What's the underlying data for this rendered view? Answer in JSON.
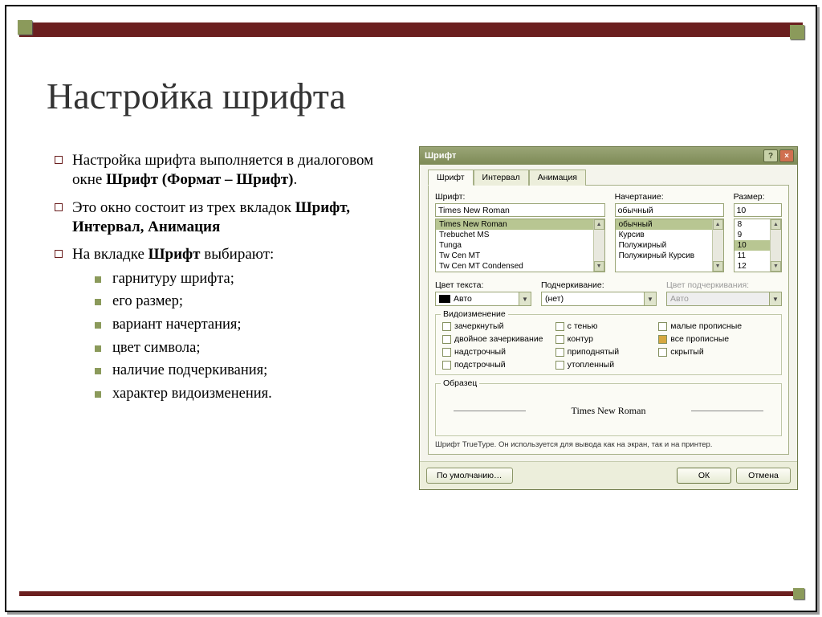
{
  "slide": {
    "title": "Настройка шрифта",
    "bullets": [
      {
        "pre": "Настройка шрифта выполняется в диалоговом окне ",
        "b": "Шрифт (Формат – Шрифт)",
        "post": "."
      },
      {
        "pre": "Это окно состоит из трех вкладок ",
        "b": "Шрифт, Интервал, Анимация",
        "post": ""
      },
      {
        "pre": "На вкладке ",
        "b": "Шрифт",
        "post": " выбирают:",
        "sub": [
          "гарнитуру шрифта;",
          "его размер;",
          "вариант начертания;",
          "цвет символа;",
          "наличие подчеркивания;",
          "характер видоизменения."
        ]
      }
    ]
  },
  "dialog": {
    "title": "Шрифт",
    "help_label": "?",
    "close_label": "×",
    "tabs": [
      "Шрифт",
      "Интервал",
      "Анимация"
    ],
    "font": {
      "label": "Шрифт:",
      "value": "Times New Roman",
      "list": [
        "Times New Roman",
        "Trebuchet MS",
        "Tunga",
        "Tw Cen MT",
        "Tw Cen MT Condensed"
      ]
    },
    "style": {
      "label": "Начертание:",
      "value": "обычный",
      "list": [
        "обычный",
        "Курсив",
        "Полужирный",
        "Полужирный Курсив"
      ]
    },
    "size": {
      "label": "Размер:",
      "value": "10",
      "list": [
        "8",
        "9",
        "10",
        "11",
        "12"
      ]
    },
    "color": {
      "label": "Цвет текста:",
      "value": "Авто"
    },
    "underline": {
      "label": "Подчеркивание:",
      "value": "(нет)"
    },
    "underline_color": {
      "label": "Цвет подчеркивания:",
      "value": "Авто"
    },
    "effects": {
      "legend": "Видоизменение",
      "col1": [
        "зачеркнутый",
        "двойное зачеркивание",
        "надстрочный",
        "подстрочный"
      ],
      "col2": [
        "с тенью",
        "контур",
        "приподнятый",
        "утопленный"
      ],
      "col3": [
        "малые прописные",
        "все прописные",
        "скрытый"
      ]
    },
    "sample": {
      "legend": "Образец",
      "text": "Times New Roman"
    },
    "hint": "Шрифт TrueType. Он используется для вывода как на экран, так и на принтер.",
    "buttons": {
      "default": "По умолчанию…",
      "ok": "ОК",
      "cancel": "Отмена"
    }
  }
}
